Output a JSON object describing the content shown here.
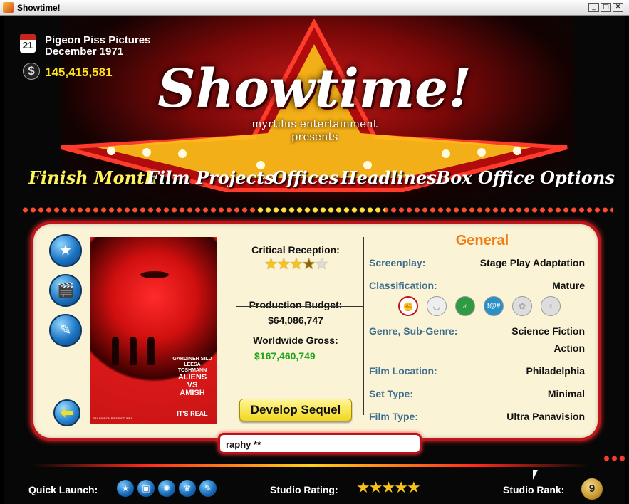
{
  "window": {
    "title": "Showtime!",
    "buttons": {
      "minimize": "_",
      "maximize": "□",
      "close": "✕"
    }
  },
  "header": {
    "logo": "Showtime!",
    "presenter_line1": "myrtilus entertainment",
    "presenter_line2": "presents"
  },
  "studio": {
    "name": "Pigeon Piss Pictures",
    "date": "December 1971",
    "calendar_day": "21",
    "money": "145,415,581",
    "dollar_symbol": "$"
  },
  "nav": {
    "items": [
      {
        "label": "Finish Month",
        "active": true
      },
      {
        "label": "Film Projects",
        "active": false
      },
      {
        "label": "Offices",
        "active": false
      },
      {
        "label": "Headlines",
        "active": false
      },
      {
        "label": "Box Office",
        "active": false
      },
      {
        "label": "Options",
        "active": false
      }
    ],
    "separator": "*"
  },
  "film": {
    "poster": {
      "credits": "GARDINER SILD LEESA TOSHMANN",
      "title_line1": "ALIENS",
      "title_line2": "VS",
      "title_line3": "AMISH",
      "tagline": "IT'S REAL",
      "small_print": "PPX PIGEON PISS PICTURES"
    },
    "critical_reception": {
      "label": "Critical Reception:",
      "rating": 3.5,
      "max": 5
    },
    "production_budget": {
      "label": "Production Budget:",
      "value": "$64,086,747"
    },
    "worldwide_gross": {
      "label": "Worldwide Gross:",
      "value": "$167,460,749"
    },
    "develop_sequel_label": "Develop Sequel"
  },
  "general": {
    "title": "General",
    "screenplay": {
      "label": "Screenplay:",
      "value": "Stage Play Adaptation"
    },
    "classification": {
      "label": "Classification:",
      "value": "Mature"
    },
    "classification_icons": [
      "violence-icon",
      "lips-icon",
      "sex-icon",
      "language-icon",
      "drugs-icon",
      "nudity-icon"
    ],
    "genre": {
      "label": "Genre, Sub-Genre:",
      "value1": "Science Fiction",
      "value2": "Action"
    },
    "film_location": {
      "label": "Film Location:",
      "value": "Philadelphia"
    },
    "set_type": {
      "label": "Set Type:",
      "value": "Minimal"
    },
    "film_type": {
      "label": "Film Type:",
      "value": "Ultra Panavision"
    }
  },
  "ticker": {
    "text": "raphy **"
  },
  "bottom_bar": {
    "quick_launch_label": "Quick Launch:",
    "quick_launch_icons": [
      "star-icon",
      "tv-icon",
      "film-reel-icon",
      "award-icon",
      "pen-icon"
    ],
    "studio_rating_label": "Studio Rating:",
    "studio_rating": 5,
    "studio_rank_label": "Studio Rank:",
    "studio_rank": "9"
  },
  "colors": {
    "accent_yellow": "#ffe41c",
    "general_title": "#f07c12",
    "label_blue": "#3f6f8f",
    "gross_green": "#22a61c",
    "panel_border": "#c0141a"
  }
}
